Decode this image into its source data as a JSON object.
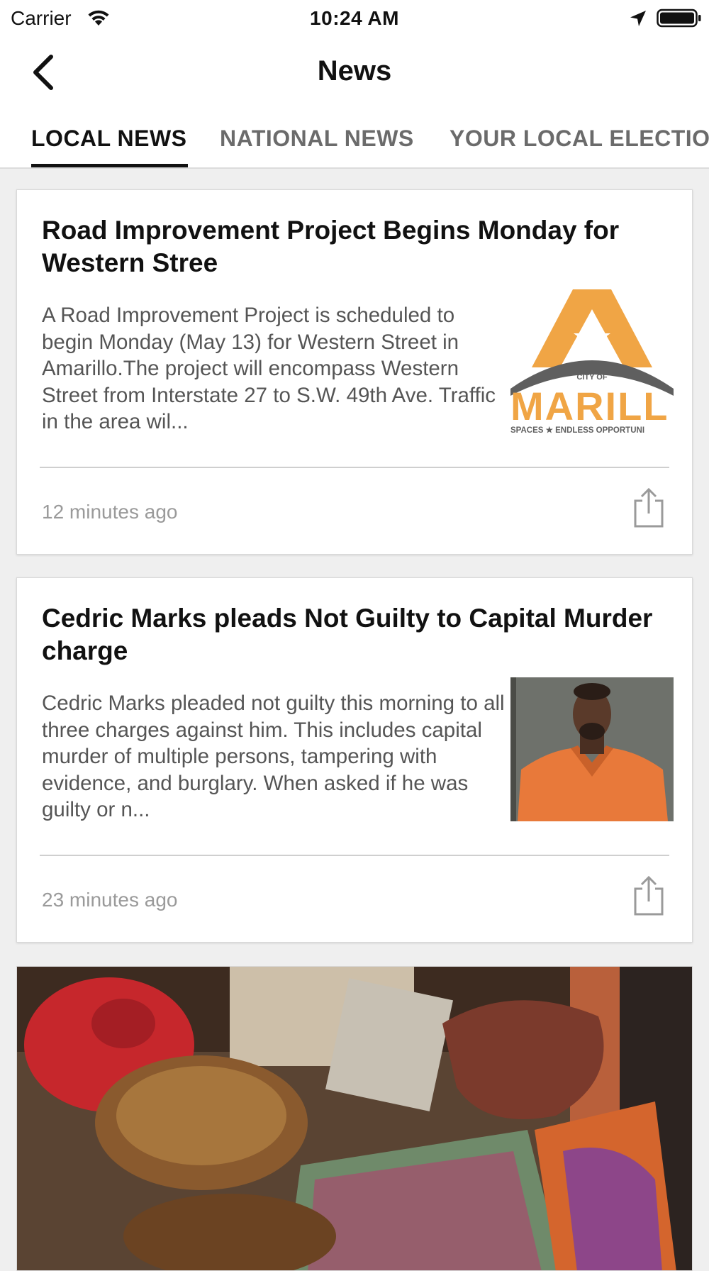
{
  "status_bar": {
    "carrier": "Carrier",
    "time": "10:24 AM"
  },
  "nav": {
    "title": "News",
    "back_icon": "chevron-left-icon"
  },
  "tabs": [
    {
      "label": "LOCAL NEWS",
      "active": true
    },
    {
      "label": "NATIONAL NEWS",
      "active": false
    },
    {
      "label": "YOUR LOCAL ELECTIO",
      "active": false
    }
  ],
  "articles": [
    {
      "title": "Road Improvement Project Begins Monday for Western Stree",
      "summary": "A Road Improvement Project is scheduled to begin Monday (May 13) for Western Street in Amarillo.The project will encompass Western Street from Interstate 27 to S.W. 49th Ave. Traffic in the area wil...",
      "timestamp": "12 minutes ago",
      "logo": {
        "city_of": "CITY OF",
        "wordmark": "MARILL",
        "tagline": "SPACES ★ ENDLESS OPPORTUNI"
      }
    },
    {
      "title": "Cedric Marks pleads Not Guilty to Capital Murder charge",
      "summary": "Cedric Marks pleaded not guilty this morning to all three charges against him. This includes capital murder of multiple persons, tampering with evidence, and burglary. When asked if he was guilty or n...",
      "timestamp": "23 minutes ago"
    }
  ],
  "colors": {
    "accent": "#111111",
    "tab_inactive": "#6b6b6b",
    "logo_orange": "#f0a545",
    "logo_gray": "#5f5f5f"
  }
}
